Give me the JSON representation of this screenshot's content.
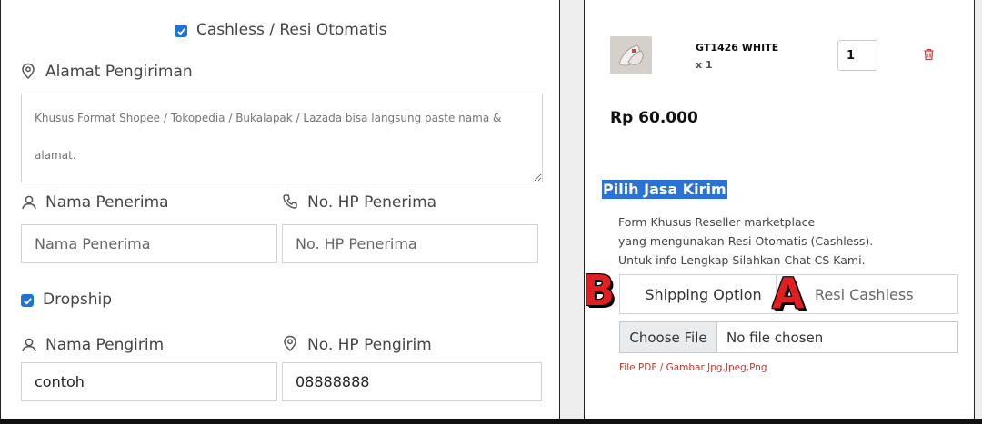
{
  "left": {
    "cashless_label": "Cashless / Resi Otomatis",
    "address_label": "Alamat Pengiriman",
    "address_placeholder": "Khusus Format Shopee / Tokopedia / Bukalapak / Lazada bisa langsung paste nama & alamat.",
    "recipient_name_label": "Nama Penerima",
    "recipient_phone_label": "No. HP Penerima",
    "recipient_name_placeholder": "Nama Penerima",
    "recipient_phone_placeholder": "No. HP Penerima",
    "dropship_label": "Dropship",
    "sender_name_label": "Nama Pengirim",
    "sender_phone_label": "No. HP Pengirim",
    "sender_name_value": "contoh",
    "sender_phone_value": "08888888"
  },
  "right": {
    "product_name": "GT1426 WHITE",
    "product_qty_text": "x 1",
    "qty_value": "1",
    "price": "Rp 60.000",
    "section_title": "Pilih Jasa Kirim",
    "info_lines": [
      "Form Khusus Reseller marketplace",
      "yang mengunakan Resi Otomatis (Cashless).",
      "Untuk info Lengkap Silahkan Chat CS Kami."
    ],
    "option_b": "Shipping Option",
    "option_a": "Resi Cashless",
    "file_button": "Choose File",
    "file_status": "No file chosen",
    "file_hint": "File PDF / Gambar Jpg,Jpeg,Png",
    "marker_b": "B",
    "marker_a": "A"
  },
  "colors": {
    "accent": "#1f73d6",
    "marker": "#e02020",
    "hint": "#c0392b"
  }
}
